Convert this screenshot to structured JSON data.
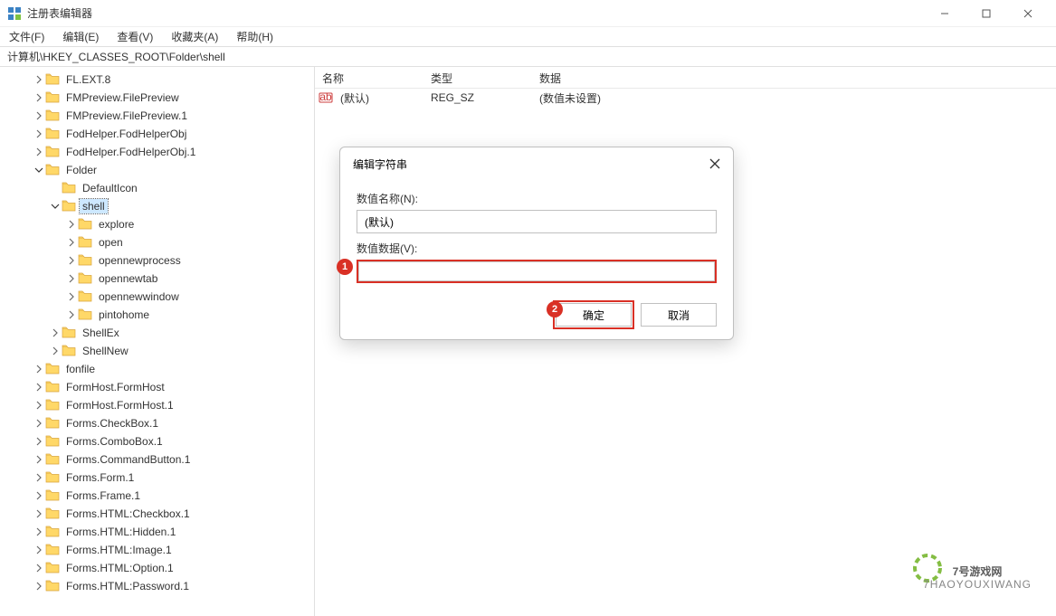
{
  "window": {
    "title": "注册表编辑器",
    "min_tooltip": "最小化",
    "max_tooltip": "最大化",
    "close_tooltip": "关闭"
  },
  "menu": {
    "file": "文件(F)",
    "edit": "编辑(E)",
    "view": "查看(V)",
    "favorites": "收藏夹(A)",
    "help": "帮助(H)"
  },
  "address": "计算机\\HKEY_CLASSES_ROOT\\Folder\\shell",
  "columns": {
    "name": "名称",
    "type": "类型",
    "data": "数据"
  },
  "row_default": {
    "name": "(默认)",
    "type": "REG_SZ",
    "data": "(数值未设置)"
  },
  "tree": [
    {
      "depth": 2,
      "label": "FL.EXT.8",
      "exp": ">"
    },
    {
      "depth": 2,
      "label": "FMPreview.FilePreview",
      "exp": ">"
    },
    {
      "depth": 2,
      "label": "FMPreview.FilePreview.1",
      "exp": ">"
    },
    {
      "depth": 2,
      "label": "FodHelper.FodHelperObj",
      "exp": ">"
    },
    {
      "depth": 2,
      "label": "FodHelper.FodHelperObj.1",
      "exp": ">"
    },
    {
      "depth": 2,
      "label": "Folder",
      "exp": "v"
    },
    {
      "depth": 3,
      "label": "DefaultIcon",
      "exp": ""
    },
    {
      "depth": 3,
      "label": "shell",
      "exp": "v",
      "sel": true
    },
    {
      "depth": 4,
      "label": "explore",
      "exp": ">"
    },
    {
      "depth": 4,
      "label": "open",
      "exp": ">"
    },
    {
      "depth": 4,
      "label": "opennewprocess",
      "exp": ">"
    },
    {
      "depth": 4,
      "label": "opennewtab",
      "exp": ">"
    },
    {
      "depth": 4,
      "label": "opennewwindow",
      "exp": ">"
    },
    {
      "depth": 4,
      "label": "pintohome",
      "exp": ">"
    },
    {
      "depth": 3,
      "label": "ShellEx",
      "exp": ">"
    },
    {
      "depth": 3,
      "label": "ShellNew",
      "exp": ">"
    },
    {
      "depth": 2,
      "label": "fonfile",
      "exp": ">"
    },
    {
      "depth": 2,
      "label": "FormHost.FormHost",
      "exp": ">"
    },
    {
      "depth": 2,
      "label": "FormHost.FormHost.1",
      "exp": ">"
    },
    {
      "depth": 2,
      "label": "Forms.CheckBox.1",
      "exp": ">"
    },
    {
      "depth": 2,
      "label": "Forms.ComboBox.1",
      "exp": ">"
    },
    {
      "depth": 2,
      "label": "Forms.CommandButton.1",
      "exp": ">"
    },
    {
      "depth": 2,
      "label": "Forms.Form.1",
      "exp": ">"
    },
    {
      "depth": 2,
      "label": "Forms.Frame.1",
      "exp": ">"
    },
    {
      "depth": 2,
      "label": "Forms.HTML:Checkbox.1",
      "exp": ">"
    },
    {
      "depth": 2,
      "label": "Forms.HTML:Hidden.1",
      "exp": ">"
    },
    {
      "depth": 2,
      "label": "Forms.HTML:Image.1",
      "exp": ">"
    },
    {
      "depth": 2,
      "label": "Forms.HTML:Option.1",
      "exp": ">"
    },
    {
      "depth": 2,
      "label": "Forms.HTML:Password.1",
      "exp": ">"
    }
  ],
  "dialog": {
    "title": "编辑字符串",
    "name_label": "数值名称(N):",
    "name_value": "(默认)",
    "data_label": "数值数据(V):",
    "data_value": "",
    "ok": "确定",
    "cancel": "取消"
  },
  "annotations": {
    "a1": "1",
    "a2": "2"
  },
  "watermark": {
    "text_top": "7号游戏网",
    "text_sub": "7HAOYOUXIWANG"
  }
}
